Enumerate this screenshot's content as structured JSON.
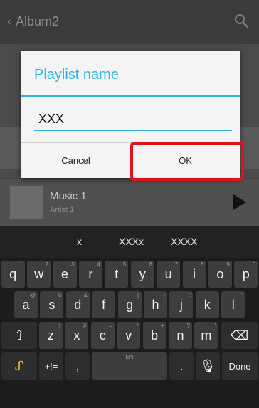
{
  "app": {
    "title": "Album2",
    "back_glyph": "‹",
    "search_icon": "search-icon"
  },
  "music_item": {
    "title": "Music 1",
    "artist": "Artist 1"
  },
  "dialog": {
    "title": "Playlist name",
    "input_value": "XXX",
    "cancel_label": "Cancel",
    "ok_label": "OK",
    "accent_color": "#2fb3e4",
    "highlight_color": "#e0131b"
  },
  "keyboard": {
    "suggestions": [
      "x",
      "XXXx",
      "XXXX"
    ],
    "row1": [
      {
        "key": "q",
        "hint": "1"
      },
      {
        "key": "w",
        "hint": "2"
      },
      {
        "key": "e",
        "hint": "3"
      },
      {
        "key": "r",
        "hint": "4"
      },
      {
        "key": "t",
        "hint": "5"
      },
      {
        "key": "y",
        "hint": "6"
      },
      {
        "key": "u",
        "hint": "7"
      },
      {
        "key": "i",
        "hint": "8"
      },
      {
        "key": "o",
        "hint": "9"
      },
      {
        "key": "p",
        "hint": "0"
      }
    ],
    "row2": [
      {
        "key": "a",
        "hint": "@"
      },
      {
        "key": "s",
        "hint": "$"
      },
      {
        "key": "d",
        "hint": "&"
      },
      {
        "key": "f",
        "hint": "_"
      },
      {
        "key": "g",
        "hint": "("
      },
      {
        "key": "h",
        "hint": ")"
      },
      {
        "key": "j",
        "hint": ":"
      },
      {
        "key": "k",
        "hint": ";"
      },
      {
        "key": "l",
        "hint": "\""
      }
    ],
    "row3": [
      {
        "key": "z",
        "hint": "!"
      },
      {
        "key": "x",
        "hint": "#"
      },
      {
        "key": "c",
        "hint": "="
      },
      {
        "key": "v",
        "hint": "/"
      },
      {
        "key": "b",
        "hint": "+"
      },
      {
        "key": "n",
        "hint": "?"
      },
      {
        "key": "m",
        "hint": "'"
      }
    ],
    "shift_glyph": "⇧",
    "backspace_glyph": "⌫",
    "symbols_label": "+!=",
    "comma_label": ",",
    "space_label": "EN",
    "period_label": ".",
    "mic_glyph": "🎤",
    "done_label": "Done"
  }
}
